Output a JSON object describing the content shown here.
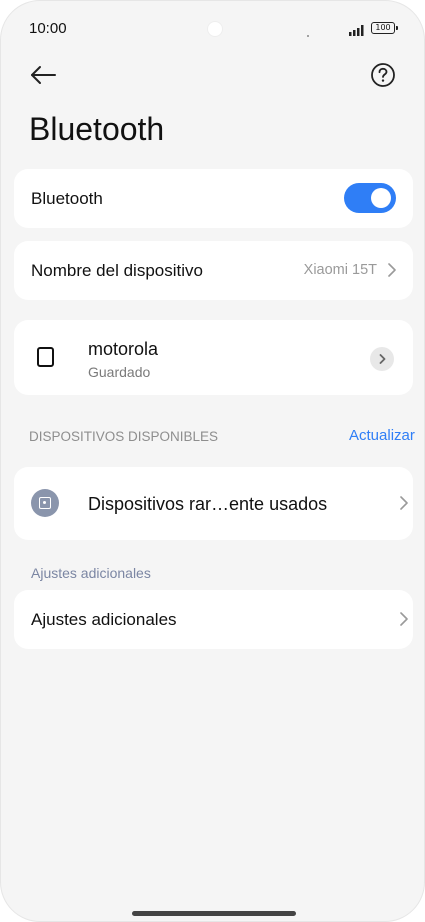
{
  "status_bar": {
    "time": "10:00",
    "battery": "100"
  },
  "header": {
    "back_icon": "arrow-left-icon",
    "help_icon": "question-circle-icon",
    "title": "Bluetooth"
  },
  "bluetooth_toggle": {
    "label": "Bluetooth",
    "state": "on",
    "accent": "#2f7ef6"
  },
  "device_name_row": {
    "label": "Nombre del dispositivo",
    "value": "Xiaomi 15T"
  },
  "paired_device": {
    "name": "motorola",
    "status": "Guardado"
  },
  "available_devices": {
    "header": "DISPOSITIVOS DISPONIBLES",
    "refresh_label": "Actualizar",
    "rare_item_label": "Dispositivos rar…ente usados"
  },
  "additional": {
    "section_label": "Ajustes adicionales",
    "item_label": "Ajustes adicionales"
  }
}
